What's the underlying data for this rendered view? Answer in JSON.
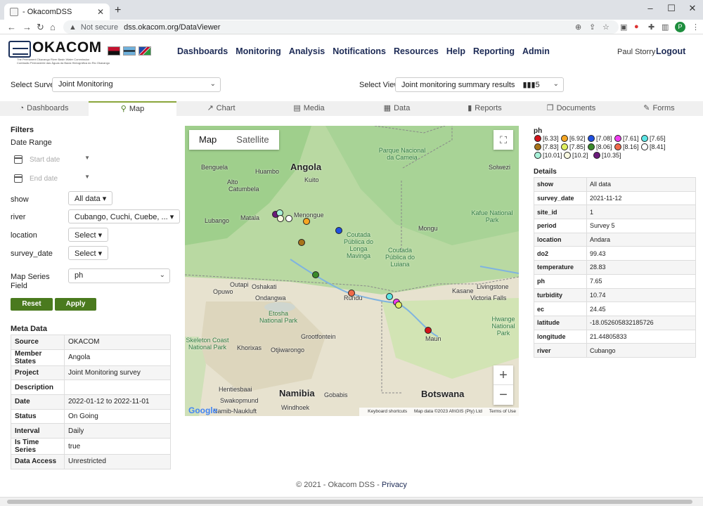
{
  "browser": {
    "tab_title": "- OkacomDSS",
    "not_secure": "Not secure",
    "url": "dss.okacom.org/DataViewer",
    "profile_initial": "P"
  },
  "site": {
    "logo_text": "OKACOM",
    "logo_tagline_1": "The Permanent Okavango River Basin Water Commission",
    "logo_tagline_2": "Comissão Permanente das Águas da Bacia Hidrográfica do Rio Okavango",
    "nav": [
      "Dashboards",
      "Monitoring",
      "Analysis",
      "Notifications",
      "Resources",
      "Help",
      "Reporting",
      "Admin"
    ],
    "user": "Paul Storry",
    "logout": "Logout"
  },
  "selectors": {
    "survey_label": "Select Survey:",
    "survey_value": "Joint Monitoring",
    "view_label": "Select View:",
    "view_value": "Joint monitoring summary results",
    "view_count": "5"
  },
  "tabs": [
    "Dashboards",
    "Map",
    "Chart",
    "Media",
    "Data",
    "Reports",
    "Documents",
    "Forms"
  ],
  "active_tab": "Map",
  "filters": {
    "title": "Filters",
    "date_range": "Date Range",
    "start_placeholder": "Start date",
    "end_placeholder": "End date",
    "show_label": "show",
    "show_value": "All data",
    "river_label": "river",
    "river_value": "Cubango, Cuchi, Cuebe, ...",
    "location_label": "location",
    "location_value": "Select",
    "survey_date_label": "survey_date",
    "survey_date_value": "Select",
    "series_label_1": "Map Series",
    "series_label_2": "Field",
    "series_value": "ph",
    "reset": "Reset Filters",
    "apply": "Apply Filters"
  },
  "meta": {
    "title": "Meta Data",
    "rows": [
      {
        "k": "Source",
        "v": "OKACOM"
      },
      {
        "k": "Member States",
        "v": "Angola"
      },
      {
        "k": "Project",
        "v": "Joint Monitoring survey"
      },
      {
        "k": "Description",
        "v": ""
      },
      {
        "k": "Date",
        "v": "2022-01-12 to 2022-11-01"
      },
      {
        "k": "Status",
        "v": "On Going"
      },
      {
        "k": "Interval",
        "v": "Daily"
      },
      {
        "k": "Is Time Series",
        "v": "true"
      },
      {
        "k": "Data Access",
        "v": "Unrestricted"
      }
    ]
  },
  "map": {
    "type_map": "Map",
    "type_satellite": "Satellite",
    "zoom_in": "+",
    "zoom_out": "−",
    "labels": {
      "angola": "Angola",
      "namibia": "Namibia",
      "botswana": "Botswana",
      "benguela": "Benguela",
      "huambo": "Huambo",
      "kuito": "Kuito",
      "catumbela": "Catumbela",
      "alto": "Alto",
      "lubango": "Lubango",
      "matala": "Matala",
      "menongue": "Menongue",
      "mongu": "Mongu",
      "solwezi": "Solwezi",
      "parque": "Parque Nacional da Cameia",
      "kafue": "Kafue National Park",
      "longa": "Coutada Pública do Longa Mavinga",
      "luiana": "Coutada Pública do Luiana",
      "opuwo": "Opuwo",
      "outapi": "Outapi",
      "oshakati": "Oshakati",
      "ondangwa": "Ondangwa",
      "rundu": "Rundu",
      "kasane": "Kasane",
      "livingstone": "Livingstone",
      "victoria": "Victoria Falls",
      "hwange": "Hwange National Park",
      "etosha": "Etosha National Park",
      "grootfontein": "Grootfontein",
      "skeleton": "Skeleton Coast National Park",
      "khorixas": "Khorixas",
      "otjiwarongo": "Otjiwarongo",
      "maun": "Maun",
      "henties": "Hentiesbaai",
      "swakop": "Swakopmund",
      "windhoek": "Windhoek",
      "gobabis": "Gobabis",
      "naukluft": "Namib-Naukluft"
    },
    "attribution_keys": "Keyboard shortcuts",
    "attribution_data": "Map data ©2023 AfriGIS (Pty) Ltd",
    "attribution_terms": "Terms of Use",
    "google": "Google"
  },
  "legend": {
    "title": "ph",
    "items": [
      {
        "label": "[6.33]",
        "color": "#d3121a"
      },
      {
        "label": "[6.92]",
        "color": "#f5a623"
      },
      {
        "label": "[7.08]",
        "color": "#1f4fe0"
      },
      {
        "label": "[7.61]",
        "color": "#f03ef0"
      },
      {
        "label": "[7.65]",
        "color": "#5ce6e6"
      },
      {
        "label": "[7.83]",
        "color": "#a8741a"
      },
      {
        "label": "[7.85]",
        "color": "#e0f060"
      },
      {
        "label": "[8.06]",
        "color": "#3a8a2a"
      },
      {
        "label": "[8.16]",
        "color": "#f06a4a"
      },
      {
        "label": "[8.41]",
        "color": "#ffffff"
      },
      {
        "label": "[10.01]",
        "color": "#a8f0d8"
      },
      {
        "label": "[10.2]",
        "color": "#f8f8e0"
      },
      {
        "label": "[10.35]",
        "color": "#6a1a7a"
      }
    ]
  },
  "details": {
    "title": "Details",
    "rows": [
      {
        "k": "show",
        "v": "All data"
      },
      {
        "k": "survey_date",
        "v": "2021-11-12"
      },
      {
        "k": "site_id",
        "v": "1"
      },
      {
        "k": "period",
        "v": "Survey 5"
      },
      {
        "k": "location",
        "v": "Andara"
      },
      {
        "k": "do2",
        "v": "99.43"
      },
      {
        "k": "temperature",
        "v": "28.83"
      },
      {
        "k": "ph",
        "v": "7.65"
      },
      {
        "k": "turbidity",
        "v": "10.74"
      },
      {
        "k": "ec",
        "v": "24.45"
      },
      {
        "k": "latitude",
        "v": "-18.052605832185726"
      },
      {
        "k": "longitude",
        "v": "21.44805833"
      },
      {
        "k": "river",
        "v": "Cubango"
      }
    ]
  },
  "footer": {
    "copyright": "© 2021 - Okacom DSS - ",
    "privacy": "Privacy"
  }
}
